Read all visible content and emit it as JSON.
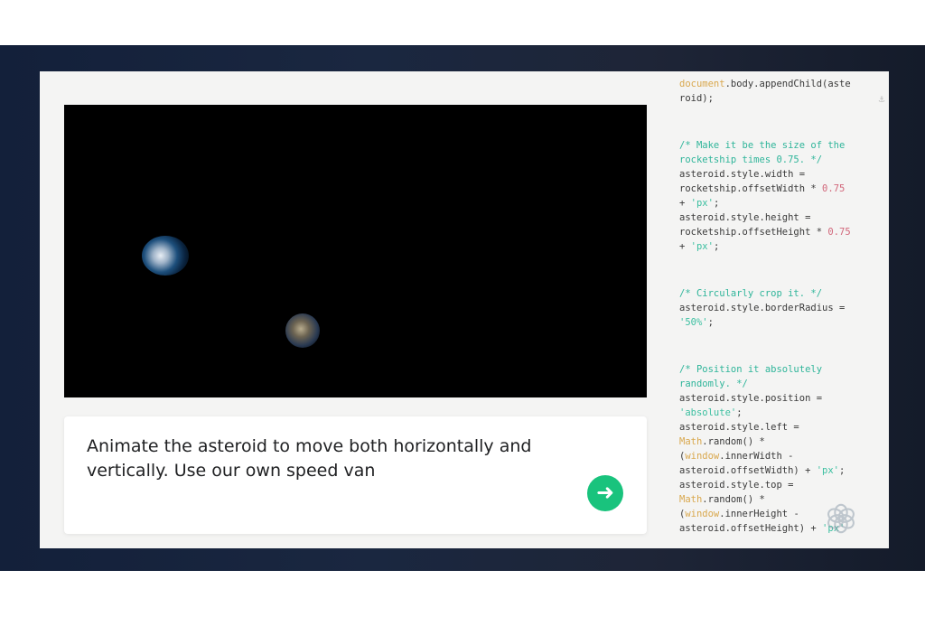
{
  "prompt": {
    "text": "Animate the asteroid to move both horizontally and vertically. Use our own speed van",
    "send_icon": "arrow-right-icon",
    "accent": "#19c37d"
  },
  "scene": {
    "objects": [
      "rocketship",
      "asteroid"
    ]
  },
  "code": {
    "blocks": [
      [
        [
          [
            "document",
            "k"
          ],
          [
            ".body.appendChild(aste",
            ""
          ]
        ],
        [
          [
            "roid);",
            ""
          ]
        ]
      ],
      [
        [
          [
            "/* Make it be the size of the",
            "c"
          ]
        ],
        [
          [
            "rocketship times 0.75. */",
            "c"
          ]
        ],
        [
          [
            "asteroid.style.width =",
            ""
          ]
        ],
        [
          [
            "rocketship.offsetWidth * ",
            ""
          ],
          [
            "0.75",
            "n"
          ]
        ],
        [
          [
            "+ ",
            ""
          ],
          [
            "'px'",
            "s"
          ],
          [
            ";",
            ""
          ]
        ],
        [
          [
            "asteroid.style.height =",
            ""
          ]
        ],
        [
          [
            "rocketship.offsetHeight * ",
            ""
          ],
          [
            "0.75",
            "n"
          ]
        ],
        [
          [
            "+ ",
            ""
          ],
          [
            "'px'",
            "s"
          ],
          [
            ";",
            ""
          ]
        ]
      ],
      [
        [
          [
            "/* Circularly crop it. */",
            "c"
          ]
        ],
        [
          [
            "asteroid.style.borderRadius =",
            ""
          ]
        ],
        [
          [
            "'50%'",
            "s"
          ],
          [
            ";",
            ""
          ]
        ]
      ],
      [
        [
          [
            "/* Position it absolutely",
            "c"
          ]
        ],
        [
          [
            "randomly. */",
            "c"
          ]
        ],
        [
          [
            "asteroid.style.position =",
            ""
          ]
        ],
        [
          [
            "'absolute'",
            "s"
          ],
          [
            ";",
            ""
          ]
        ],
        [
          [
            "asteroid.style.left =",
            ""
          ]
        ],
        [
          [
            "Math",
            "k"
          ],
          [
            ".random() *",
            ""
          ]
        ],
        [
          [
            "(",
            ""
          ],
          [
            "window",
            "k"
          ],
          [
            ".innerWidth -",
            ""
          ]
        ],
        [
          [
            "asteroid.offsetWidth) + ",
            ""
          ],
          [
            "'px'",
            "s"
          ],
          [
            ";",
            ""
          ]
        ],
        [
          [
            "asteroid.style.top =",
            ""
          ]
        ],
        [
          [
            "Math",
            "k"
          ],
          [
            ".random() *",
            ""
          ]
        ],
        [
          [
            "(",
            ""
          ],
          [
            "window",
            "k"
          ],
          [
            ".innerHeight -",
            ""
          ]
        ],
        [
          [
            "asteroid.offsetHeight) + ",
            ""
          ],
          [
            "'px'",
            "s"
          ]
        ]
      ]
    ]
  },
  "watermark": {
    "icon": "openai-logo-icon"
  }
}
